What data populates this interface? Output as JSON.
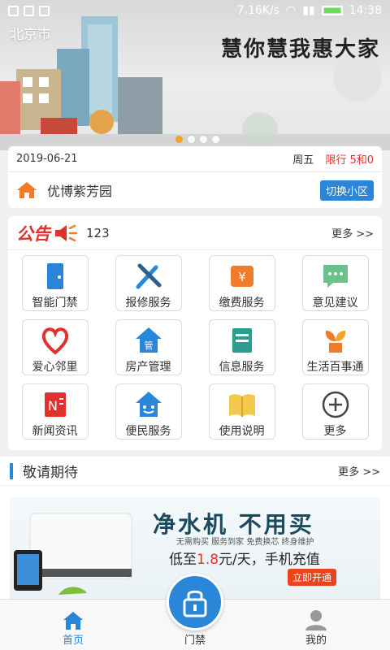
{
  "status_bar": {
    "speed": "7.16K/s",
    "time": "14:38"
  },
  "header": {
    "city": "北京市",
    "slogan": "慧你慧我惠大家"
  },
  "info": {
    "date": "2019-06-21",
    "weekday": "周五",
    "limit": "限行 5和0",
    "community": "优博紫芳园",
    "switch_label": "切换小区"
  },
  "notice": {
    "title": "公告",
    "text": "123",
    "more": "更多 >>"
  },
  "services": [
    {
      "label": "智能门禁",
      "icon": "door-icon"
    },
    {
      "label": "报修服务",
      "icon": "tools-icon"
    },
    {
      "label": "缴费服务",
      "icon": "payment-icon"
    },
    {
      "label": "意见建议",
      "icon": "chat-icon"
    },
    {
      "label": "爱心邻里",
      "icon": "heart-icon"
    },
    {
      "label": "房产管理",
      "icon": "house-icon"
    },
    {
      "label": "信息服务",
      "icon": "book-icon"
    },
    {
      "label": "生活百事通",
      "icon": "plant-icon"
    },
    {
      "label": "新闻资讯",
      "icon": "news-icon"
    },
    {
      "label": "便民服务",
      "icon": "smile-house-icon"
    },
    {
      "label": "使用说明",
      "icon": "manual-icon"
    },
    {
      "label": "更多",
      "icon": "plus-icon"
    }
  ],
  "coming_soon": {
    "title": "敬请期待",
    "more": "更多 >>",
    "ad": {
      "title": "净水机  不用买",
      "subtitle": "无需购买 服务到家 免费换芯 终身维护",
      "price_prefix": "低至",
      "price_value": "1.8",
      "price_suffix": "元/天，手机充值",
      "button": "立即开通"
    }
  },
  "bottom_nav": {
    "home": "首页",
    "door": "门禁",
    "mine": "我的"
  },
  "colors": {
    "accent": "#2a86d9",
    "alert": "#e0322b",
    "active_dot": "#f4a12e"
  }
}
